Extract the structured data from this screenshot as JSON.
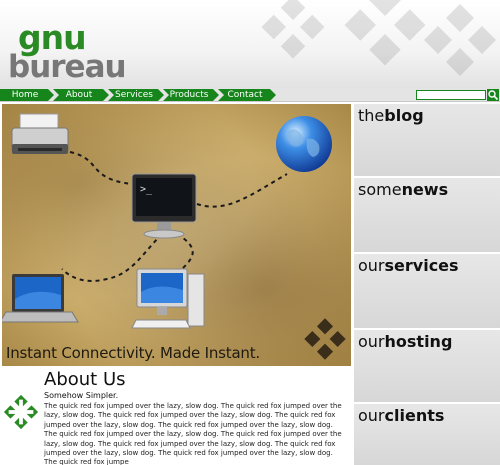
{
  "logo": {
    "line1": "gnu",
    "line2": "bureau"
  },
  "nav": {
    "items": [
      {
        "label": "Home"
      },
      {
        "label": "About"
      },
      {
        "label": "Services"
      },
      {
        "label": "Products"
      },
      {
        "label": "Contact"
      }
    ],
    "search_value": ""
  },
  "hero": {
    "tagline": "Instant Connectivity.  Made Instant."
  },
  "sidebar": {
    "items": [
      {
        "prefix": "the",
        "bold": "blog"
      },
      {
        "prefix": "some",
        "bold": "news"
      },
      {
        "prefix": "our",
        "bold": "services"
      },
      {
        "prefix": "our",
        "bold": "hosting"
      },
      {
        "prefix": "our",
        "bold": "clients"
      }
    ]
  },
  "about": {
    "title": "About Us",
    "subtitle": "Somehow Simpler.",
    "body": "The quick red fox jumped over the lazy, slow dog.  The quick red fox jumped over the lazy, slow dog.  The quick red fox jumped over the lazy, slow dog.  The quick red fox jumped over the lazy, slow dog.  The quick red fox jumped over the lazy, slow dog.  The quick red fox jumped over the lazy, slow dog.  The quick red fox jumped over the lazy, slow dog.  The quick red fox jumped over the lazy, slow dog.  The quick red fox jumped over the lazy, slow dog.  The quick red fox jumped over the lazy, slow dog.  The quick red fox jumpe"
  },
  "colors": {
    "accent": "#16861c",
    "logo_green": "#2a8a24",
    "logo_gray": "#777777"
  },
  "icons": [
    "knot-logo-icon",
    "search-icon",
    "printer-icon",
    "monitor-icon",
    "globe-icon",
    "laptop-icon",
    "desktop-pc-icon"
  ]
}
